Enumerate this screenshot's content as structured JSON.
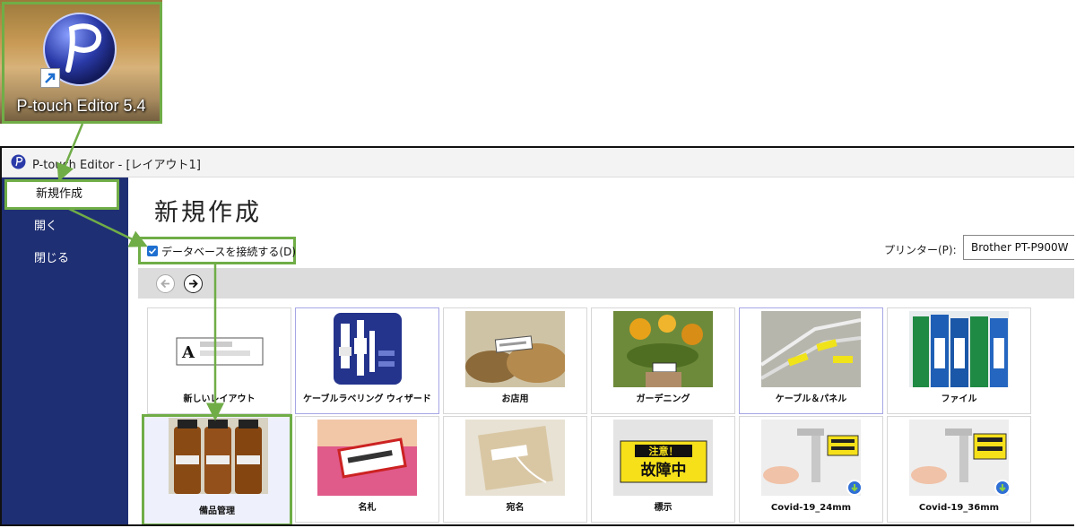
{
  "desktop": {
    "shortcut_label": "P-touch Editor 5.4",
    "icon": "p-touch-logo-icon"
  },
  "window": {
    "title": "P-touch Editor - [レイアウト1]"
  },
  "sidebar": {
    "items": [
      {
        "label": "新規作成",
        "selected": true
      },
      {
        "label": "開く"
      },
      {
        "label": "閉じる"
      }
    ]
  },
  "main": {
    "title": "新規作成",
    "db_checkbox": {
      "label": "データベースを接続する(D)",
      "checked": true
    },
    "printer_label": "プリンター(P):",
    "printer_value": "Brother PT-P900W"
  },
  "templates": [
    {
      "label": "新しいレイアウト",
      "thumb": "blank-layout"
    },
    {
      "label": "ケーブルラベリング ウィザード",
      "thumb": "cable-wizard"
    },
    {
      "label": "お店用",
      "thumb": "shop"
    },
    {
      "label": "ガーデニング",
      "thumb": "gardening"
    },
    {
      "label": "ケーブル＆パネル",
      "thumb": "cable-panel"
    },
    {
      "label": "ファイル",
      "thumb": "file"
    },
    {
      "label": "備品管理",
      "thumb": "equipment"
    },
    {
      "label": "名札",
      "thumb": "name-tag"
    },
    {
      "label": "宛名",
      "thumb": "address"
    },
    {
      "label": "標示",
      "thumb": "sign",
      "sign_line1": "注意！",
      "sign_line2": "故障中"
    },
    {
      "label": "Covid-19_24mm",
      "thumb": "covid"
    },
    {
      "label": "Covid-19_36mm",
      "thumb": "covid"
    }
  ],
  "colors": {
    "accent_green": "#70ad47",
    "sidebar_bg": "#1f2f73",
    "logo_blue": "#2a3aa8"
  }
}
